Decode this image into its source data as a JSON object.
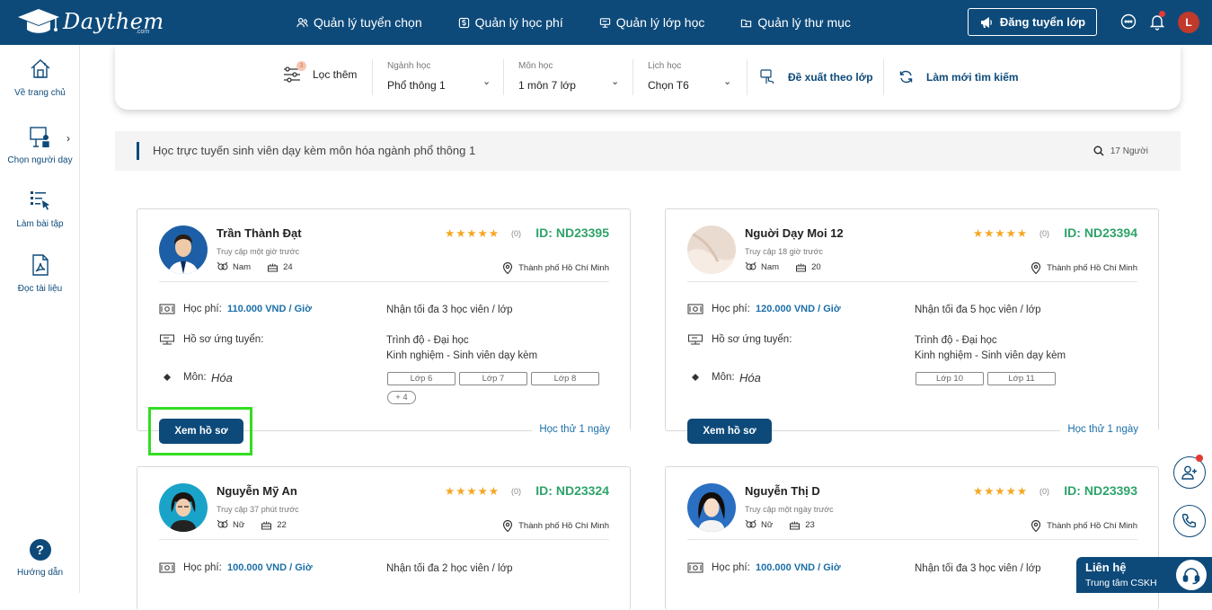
{
  "header": {
    "logo_text": "Daythem",
    "logo_sub": ".com",
    "nav": [
      {
        "label": "Quản lý tuyển chọn",
        "icon": "people-icon"
      },
      {
        "label": "Quản lý học phí",
        "icon": "dollar-icon"
      },
      {
        "label": "Quản lý lớp học",
        "icon": "classroom-icon"
      },
      {
        "label": "Quản lý thư mục",
        "icon": "folder-icon"
      }
    ],
    "post_button": "Đăng tuyển lớp",
    "avatar_letter": "L"
  },
  "sidebar": {
    "items": [
      {
        "label": "Về trang chủ",
        "icon": "home-icon"
      },
      {
        "label": "Chọn người dạy",
        "icon": "teacher-icon"
      },
      {
        "label": "Làm bài tập",
        "icon": "exercise-icon"
      },
      {
        "label": "Đọc tài liệu",
        "icon": "pdf-icon"
      }
    ],
    "help_label": "Hướng dẫn"
  },
  "filters": {
    "more_label": "Lọc thêm",
    "more_count": "3",
    "major": {
      "label": "Ngành học",
      "value": "Phổ thông 1"
    },
    "subject": {
      "label": "Môn học",
      "value": "1 môn 7 lớp"
    },
    "schedule": {
      "label": "Lịch học",
      "value": "Chọn T6"
    },
    "suggest_label": "Đề xuất theo lớp",
    "refresh_label": "Làm mới tìm kiếm"
  },
  "results": {
    "title": "Học trực tuyến sinh viên dạy kèm môn hóa ngành phổ thông 1",
    "count": "17 Người"
  },
  "labels": {
    "fee": "Học phí:",
    "profile": "Hồ sơ ứng tuyển:",
    "subject": "Môn:",
    "view_profile": "Xem hồ sơ",
    "trial": "Học thử 1 ngày"
  },
  "tutors": [
    {
      "name": "Trần Thành Đạt",
      "access": "Truy cập một giờ trước",
      "gender": "Nam",
      "age": "24",
      "stars": "★★★★★",
      "rating_count": "(0)",
      "id": "ID: ND23395",
      "location": "Thành phố Hồ Chí Minh",
      "fee": "110.000 VND / Giờ",
      "capacity": "Nhận tối đa 3 học viên / lớp",
      "level": "Trình độ - Đại học",
      "experience": "Kinh nghiệm - Sinh viên dạy kèm",
      "subject": "Hóa",
      "grades": [
        "Lớp 6",
        "Lớp 7",
        "Lớp 8"
      ],
      "more": "+ 4"
    },
    {
      "name": "Nguời Dạy Moi 12",
      "access": "Truy cập 18 giờ trước",
      "gender": "Nam",
      "age": "20",
      "stars": "★★★★★",
      "rating_count": "(0)",
      "id": "ID: ND23394",
      "location": "Thành phố Hồ Chí Minh",
      "fee": "120.000 VND / Giờ",
      "capacity": "Nhận tối đa 5 học viên / lớp",
      "level": "Trình độ - Đại học",
      "experience": "Kinh nghiệm - Sinh viên dạy kèm",
      "subject": "Hóa",
      "grades": [
        "Lớp 10",
        "Lớp 11"
      ]
    },
    {
      "name": "Nguyễn Mỹ An",
      "access": "Truy cập 37 phút trước",
      "gender": "Nữ",
      "age": "22",
      "stars": "★★★★★",
      "rating_count": "(0)",
      "id": "ID: ND23324",
      "location": "Thành phố Hồ Chí Minh",
      "fee": "100.000 VND / Giờ",
      "capacity": "Nhận tối đa 2 học viên / lớp"
    },
    {
      "name": "Nguyễn Thị D",
      "access": "Truy cập một ngày trước",
      "gender": "Nữ",
      "age": "23",
      "stars": "★★★★★",
      "rating_count": "(0)",
      "id": "ID: ND23393",
      "location": "Thành phố Hồ Chí Minh",
      "fee": "100.000 VND / Giờ",
      "capacity": "Nhận tối đa 3 học viên / lớp"
    }
  ],
  "contact": {
    "title": "Liên hệ",
    "subtitle": "Trung tâm CSKH"
  },
  "colors": {
    "primary": "#0d4a7a",
    "accent_green": "#2ea36a",
    "star": "#f5a623",
    "highlight": "#33dd22"
  }
}
